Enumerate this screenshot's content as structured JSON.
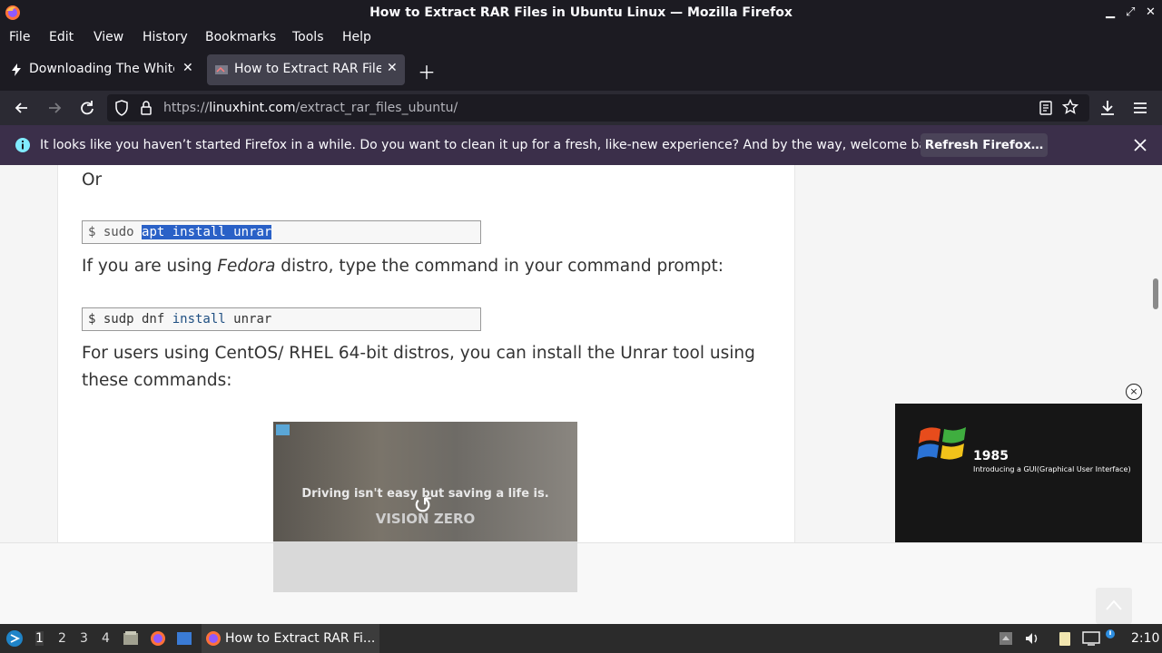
{
  "window": {
    "title": "How to Extract RAR Files in Ubuntu Linux — Mozilla Firefox",
    "controls": [
      "minimize",
      "maximize",
      "close"
    ]
  },
  "menu": {
    "items": [
      "File",
      "Edit",
      "View",
      "History",
      "Bookmarks",
      "Tools",
      "Help"
    ]
  },
  "tabs": [
    {
      "label": "Downloading The White House",
      "active": false
    },
    {
      "label": "How to Extract RAR Files",
      "active": true
    }
  ],
  "nav": {
    "url_prefix": "https://",
    "url_domain": "linuxhint.com",
    "url_path": "/extract_rar_files_ubuntu/"
  },
  "notification": {
    "text": "It looks like you haven’t started Firefox in a while. Do you want to clean it up for a fresh, like-new experience? And by the way, welcome back!",
    "button": "Refresh Firefox…"
  },
  "article": {
    "or": "Or",
    "code1_prompt": "$ sudo ",
    "code1_selected": "apt install unrar",
    "fedora_pre": "If you are using ",
    "fedora_em": "Fedora",
    "fedora_post": " distro, type the command in your command prompt:",
    "code2_prompt": "$ sudp dnf ",
    "code2_kw": "install",
    "code2_rest": " unrar",
    "centos_line1": "For users using CentOS/ RHEL 64-bit distros, you can install the Unrar tool using",
    "centos_line2": "these commands:"
  },
  "video": {
    "caption1": "Driving isn't easy but saving a life is.",
    "caption2": "VISION ZERO"
  },
  "side_ad": {
    "year": "1985",
    "subtitle": "Introducing a GUI(Graphical User Interface)"
  },
  "taskbar": {
    "workspaces": [
      "1",
      "2",
      "3",
      "4"
    ],
    "current_workspace": "1",
    "task_label": "How to Extract RAR Fi...",
    "clock": "2:10"
  },
  "colors": {
    "chrome_dark": "#1c1b22",
    "toolbar": "#2b2a33",
    "notification": "#3b2f4a",
    "selection": "#2a61c7"
  }
}
